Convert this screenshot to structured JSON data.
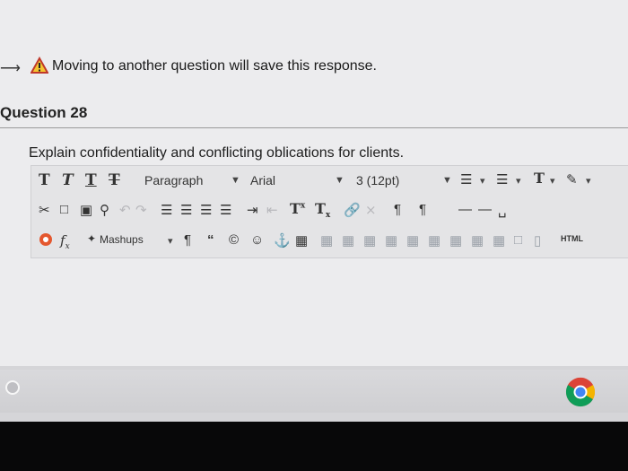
{
  "warning": {
    "arrow_glyph": "⟶",
    "icon": "warning-icon",
    "text": "Moving to another question will save this response."
  },
  "question": {
    "title": "Question 28",
    "prompt": "Explain confidentiality and conflicting oblications for clients."
  },
  "toolbar": {
    "row1": {
      "format_buttons": [
        "T",
        "T",
        "T",
        "T"
      ],
      "paragraph_select": "Paragraph",
      "font_select": "Arial",
      "size_select": "3 (12pt)"
    },
    "row2": {
      "superscript_label": "T",
      "subscript_label": "T"
    },
    "row3": {
      "mashups_label": "Mashups",
      "html_label": "HTML"
    }
  },
  "colors": {
    "accent_orange": "#e4572e",
    "warning_red": "#c0392b",
    "warning_yellow": "#f4c430",
    "chrome_red": "#db4437",
    "chrome_yellow": "#f4b400",
    "chrome_green": "#0f9d58",
    "chrome_blue": "#4285f4"
  }
}
